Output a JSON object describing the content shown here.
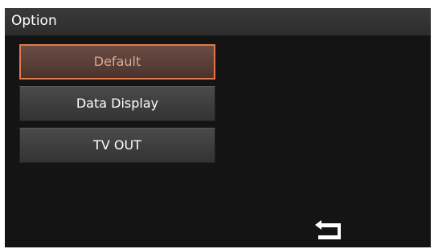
{
  "header": {
    "title": "Option"
  },
  "menu": {
    "items": [
      {
        "label": "Default",
        "selected": true
      },
      {
        "label": "Data Display",
        "selected": false
      },
      {
        "label": "TV OUT",
        "selected": false
      }
    ]
  },
  "footer": {
    "back_icon": "back-arrow-icon"
  },
  "colors": {
    "background": "#141414",
    "title_bar": "#333333",
    "button": "#3d3d3d",
    "selected_button": "#5a3f38",
    "selected_border": "#e0784a",
    "text": "#ffffff"
  }
}
